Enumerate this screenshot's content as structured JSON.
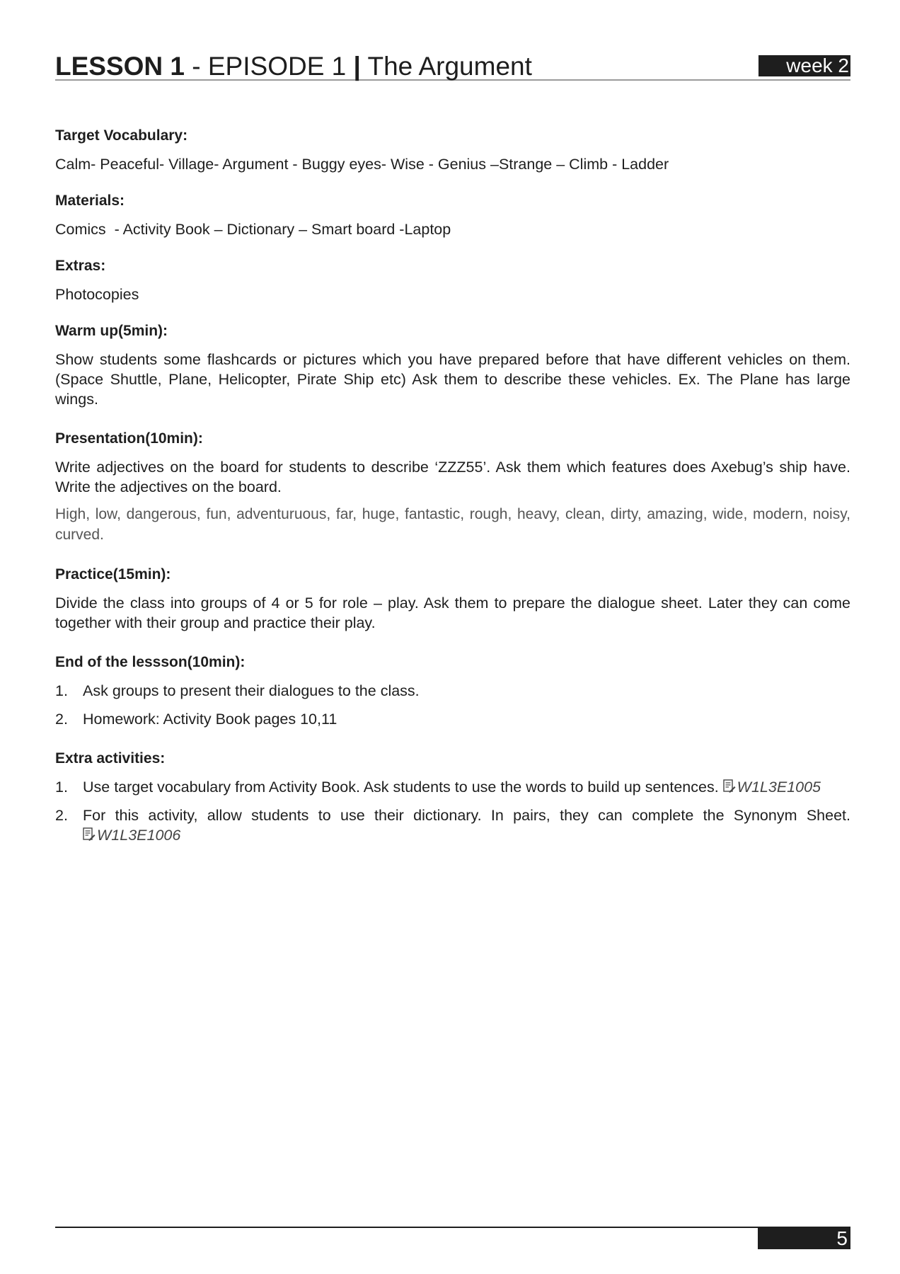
{
  "header": {
    "lesson_label": "LESSON 1",
    "episode": " - EPISODE 1 ",
    "separator": "|",
    "title": " The Argument",
    "week": "week 2"
  },
  "sections": {
    "vocabulary": {
      "heading": "Target Vocabulary:",
      "text": "Calm- Peaceful- Village- Argument - Buggy eyes- Wise - Genius –Strange – Climb - Ladder"
    },
    "materials": {
      "heading": "Materials:",
      "text": "Comics  - Activity Book – Dictionary – Smart board -Laptop"
    },
    "extras": {
      "heading": "Extras:",
      "text": "Photocopies"
    },
    "warmup": {
      "heading": "Warm up(5min):",
      "text": "Show students some flashcards or pictures which you have prepared before that have different vehicles on them. (Space Shuttle, Plane, Helicopter, Pirate Ship etc) Ask them to describe these vehicles. Ex. The Plane has large wings."
    },
    "presentation": {
      "heading": "Presentation(10min):",
      "text": "Write adjectives on the board for students to describe ‘ZZZ55’. Ask them which features does Axebug’s ship have. Write the adjectives on the board.",
      "adjectives": "High, low, dangerous, fun, adventuruous, far, huge, fantastic, rough, heavy, clean, dirty, amazing, wide, modern, noisy, curved."
    },
    "practice": {
      "heading": "Practice(15min):",
      "text": "Divide the class into groups of 4 or 5 for role – play. Ask them to prepare the dialogue sheet. Later they can come together with their group and practice their play."
    },
    "end": {
      "heading": "End of the lessson(10min):",
      "items": [
        {
          "num": "1.",
          "text": "Ask groups to present their dialogues to the class."
        },
        {
          "num": "2.",
          "text": "Homework: Activity Book pages 10,11"
        }
      ]
    },
    "extra_activities": {
      "heading": "Extra activities:",
      "items": [
        {
          "num": "1.",
          "text": "Use target vocabulary from Activity Book. Ask students to use the words to build up sentences.",
          "ref": "W1L3E1005",
          "icon": "document-edit-icon"
        },
        {
          "num": "2.",
          "text": "For this activity, allow students to use their dictionary. In pairs, they can complete the Synonym Sheet.",
          "ref": "W1L3E1006",
          "icon": "document-edit-icon"
        }
      ]
    }
  },
  "footer": {
    "page_number": "5"
  }
}
